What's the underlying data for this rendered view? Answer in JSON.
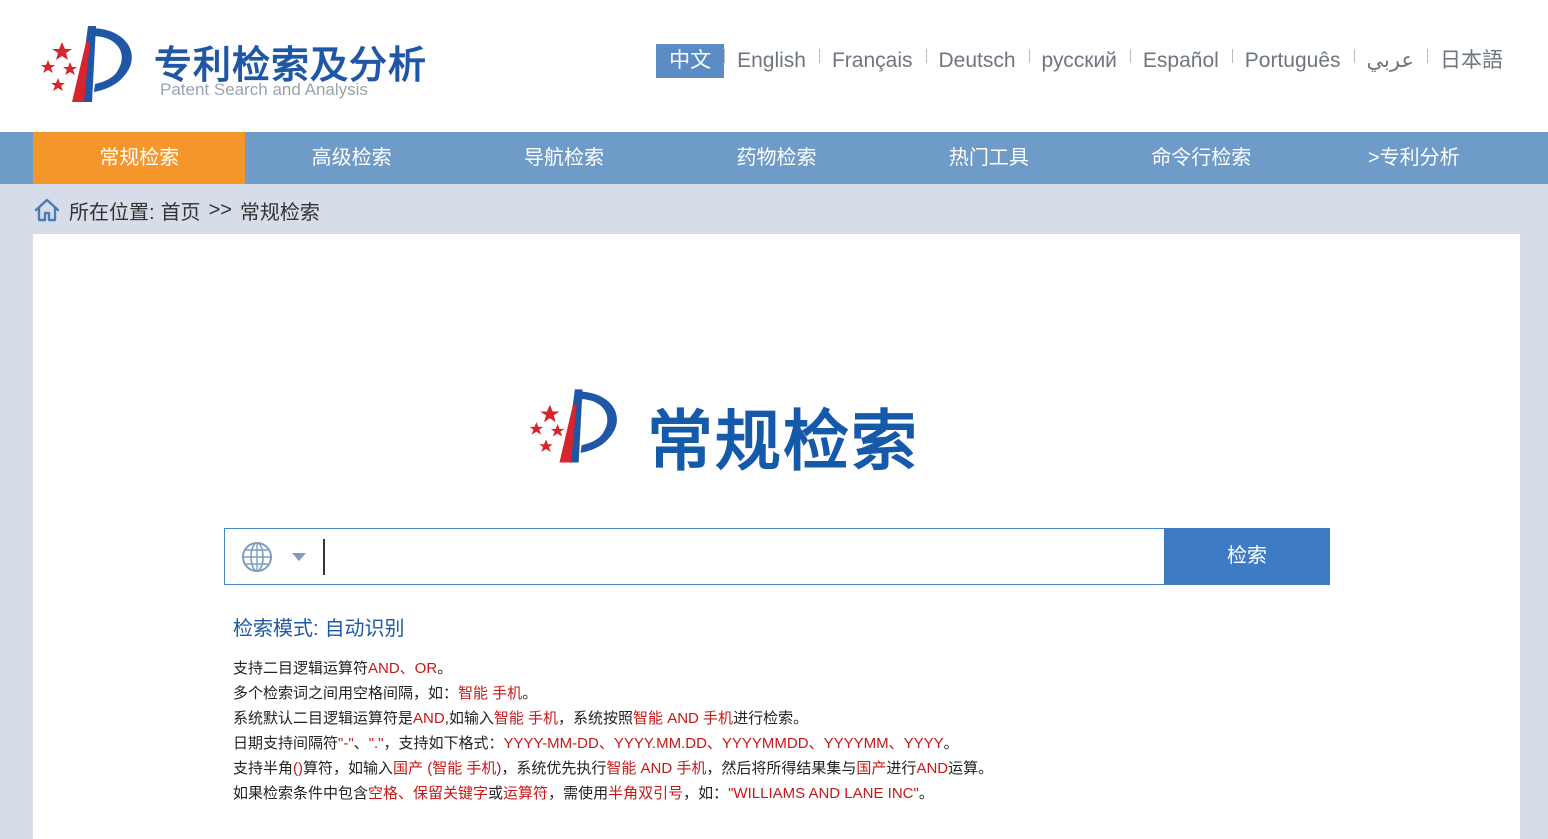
{
  "header": {
    "logo_title": "专利检索及分析",
    "logo_subtitle": "Patent Search and Analysis",
    "languages": [
      "中文",
      "English",
      "Français",
      "Deutsch",
      "русский",
      "Español",
      "Português",
      "عربي",
      "日本語"
    ],
    "active_language": "中文"
  },
  "nav": {
    "items": [
      "常规检索",
      "高级检索",
      "导航检索",
      "药物检索",
      "热门工具",
      "命令行检索",
      ">专利分析"
    ],
    "active": "常规检索"
  },
  "breadcrumb": {
    "prefix": "所在位置:",
    "home": "首页",
    "separator": ">>",
    "current": "常规检索"
  },
  "main": {
    "title": "常规检索",
    "search": {
      "value": "",
      "placeholder": "",
      "button_label": "检索"
    },
    "mode_label": "检索模式:",
    "mode_value": "自动识别",
    "tips": [
      [
        {
          "t": "支持二目逻辑运算符"
        },
        {
          "t": "AND、OR",
          "r": true
        },
        {
          "t": "。"
        }
      ],
      [
        {
          "t": "多个检索词之间用空格间隔，如："
        },
        {
          "t": "智能 手机",
          "r": true
        },
        {
          "t": "。"
        }
      ],
      [
        {
          "t": "系统默认二目逻辑运算符是"
        },
        {
          "t": "AND",
          "r": true
        },
        {
          "t": ",如输入"
        },
        {
          "t": "智能 手机",
          "r": true
        },
        {
          "t": "，系统按照"
        },
        {
          "t": "智能 AND 手机",
          "r": true
        },
        {
          "t": "进行检索。"
        }
      ],
      [
        {
          "t": "日期支持间隔符"
        },
        {
          "t": "\"-\"",
          "r": true
        },
        {
          "t": "、"
        },
        {
          "t": "\".\"",
          "r": true
        },
        {
          "t": "，支持如下格式："
        },
        {
          "t": "YYYY-MM-DD、YYYY.MM.DD、YYYYMMDD、YYYYMM、YYYY",
          "r": true
        },
        {
          "t": "。"
        }
      ],
      [
        {
          "t": "支持半角"
        },
        {
          "t": "()",
          "r": true
        },
        {
          "t": "算符，如输入"
        },
        {
          "t": "国产 (智能 手机)",
          "r": true
        },
        {
          "t": "，系统优先执行"
        },
        {
          "t": "智能 AND 手机",
          "r": true
        },
        {
          "t": "，然后将所得结果集与"
        },
        {
          "t": "国产",
          "r": true
        },
        {
          "t": "进行"
        },
        {
          "t": "AND",
          "r": true
        },
        {
          "t": "运算。"
        }
      ],
      [
        {
          "t": "如果检索条件中包含"
        },
        {
          "t": "空格、保留关键字",
          "r": true
        },
        {
          "t": "或"
        },
        {
          "t": "运算符",
          "r": true
        },
        {
          "t": "，需使用"
        },
        {
          "t": "半角双引号",
          "r": true
        },
        {
          "t": "，如："
        },
        {
          "t": "\"WILLIAMS AND LANE INC\"",
          "r": true
        },
        {
          "t": "。"
        }
      ]
    ]
  },
  "colors": {
    "brand_blue": "#1f57a6",
    "nav_bg": "#6f9bc8",
    "nav_active": "#f5962a",
    "accent_red": "#c81818"
  },
  "icons": {
    "logo": "patent-office-logo",
    "home": "home-icon",
    "globe": "globe-icon",
    "dropdown": "caret-down-icon"
  }
}
